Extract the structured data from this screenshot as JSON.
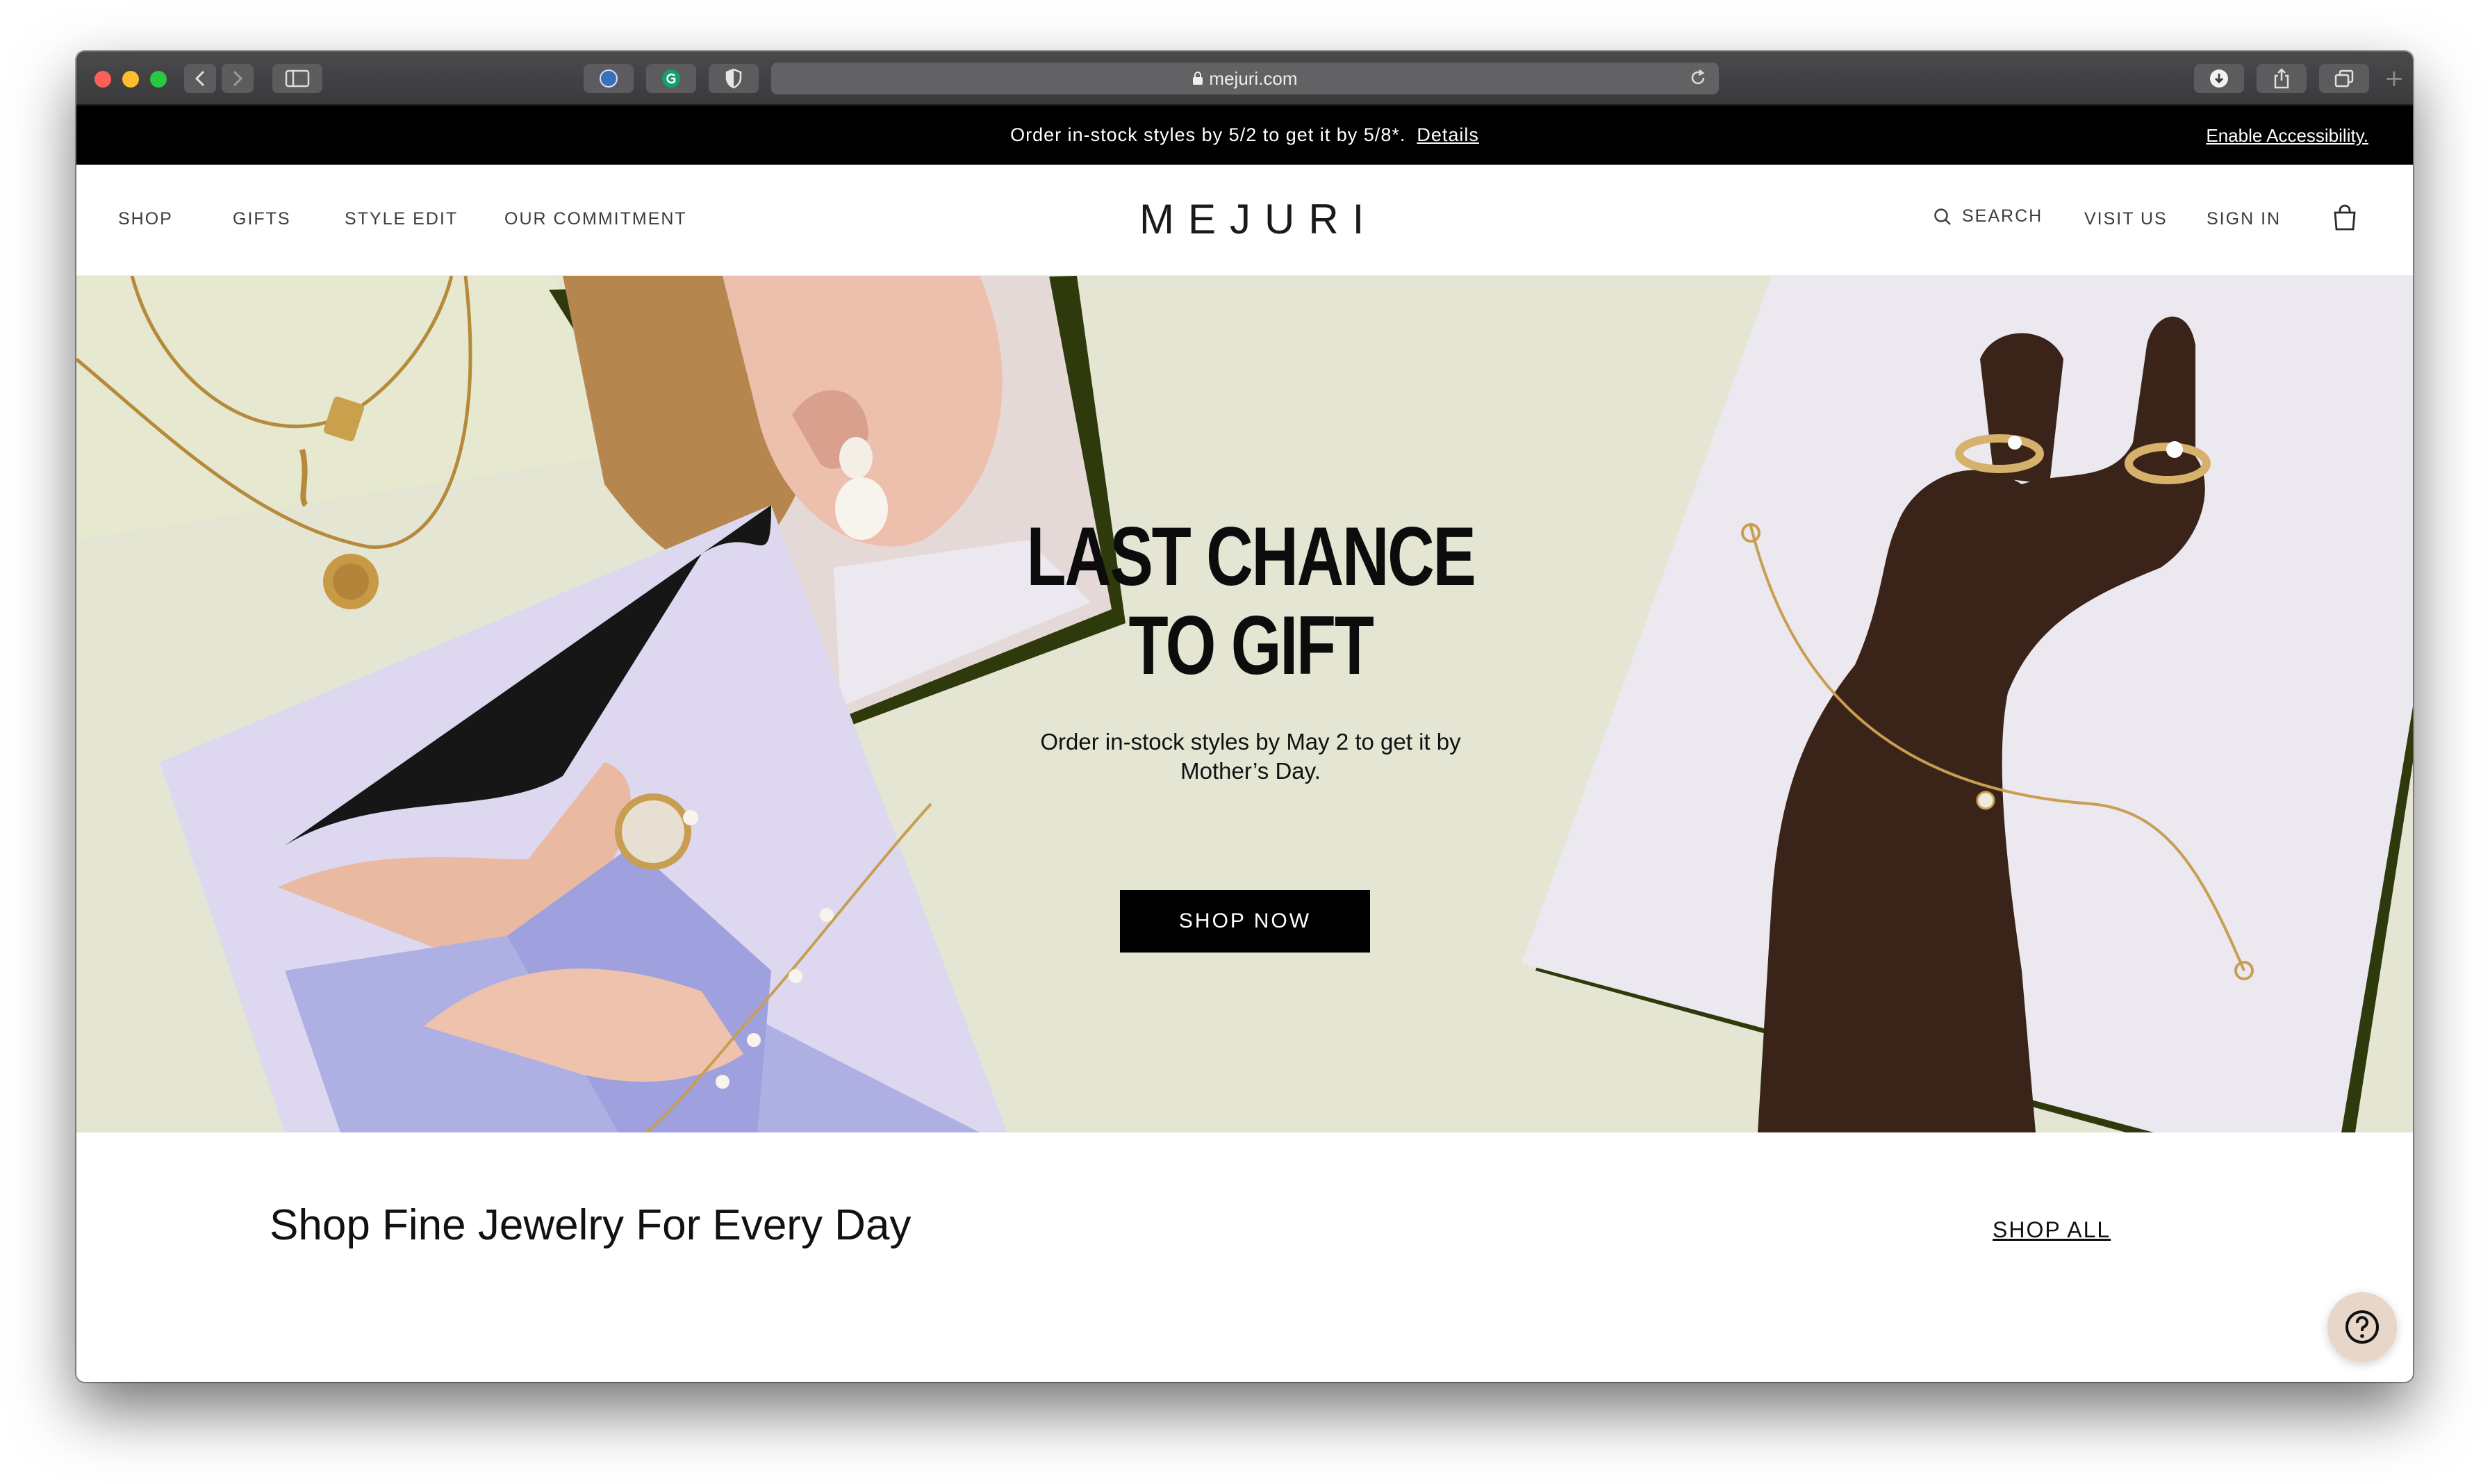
{
  "browser": {
    "url": "mejuri.com",
    "new_tab_symbol": "+"
  },
  "announcement": {
    "message": "Order in-stock styles by 5/2 to get it by 5/8*.",
    "details_link": "Details",
    "accessibility_link": "Enable Accessibility."
  },
  "nav": {
    "left_items": [
      "SHOP",
      "GIFTS",
      "STYLE EDIT",
      "OUR COMMITMENT"
    ],
    "logo": "MEJURI",
    "search_label": "SEARCH",
    "visit_label": "VISIT US",
    "signin_label": "SIGN IN"
  },
  "hero": {
    "title_line1": "LAST CHANCE",
    "title_line2": "TO GIFT",
    "subtitle": "Order in-stock styles by May 2 to get it by Mother’s Day.",
    "button_label": "SHOP NOW",
    "background_color": "#e4e6d3"
  },
  "section": {
    "title": "Shop Fine Jewelry For Every Day",
    "link_label": "SHOP ALL"
  },
  "help": {
    "icon": "help-question-icon",
    "accent": "#e8d6c8"
  }
}
